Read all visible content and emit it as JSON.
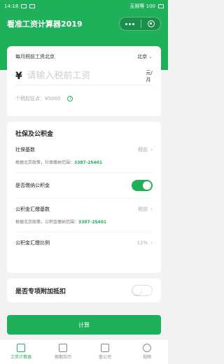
{
  "status_bar": {
    "time": "14:18",
    "right_text": "无限等 100"
  },
  "header": {
    "title": "看准工资计算器2019"
  },
  "salary": {
    "label": "每月税前工资北京",
    "city": "北京",
    "currency_symbol": "¥",
    "placeholder": "请输入税前工资",
    "unit": "元/月",
    "threshold_label": "个税起征点：¥5000"
  },
  "social": {
    "title": "社保及公积金",
    "base_label": "社保基数",
    "base_hint": "税前",
    "base_note_prefix": "根据北京政策，社保缴纳范围：",
    "base_range": "3387-25401",
    "fund_toggle_label": "是否缴纳公积金",
    "fund_base_label": "公积金汇缴基数",
    "fund_base_hint": "税前",
    "fund_note_prefix": "根据北京政策，公积金缴纳范围：",
    "fund_range": "3387-25401",
    "ratio_label": "公积金汇缴比例",
    "ratio_value": "12%",
    "fund_enabled": true
  },
  "special": {
    "label": "是否专项附加抵扣",
    "enabled": false
  },
  "calc_label": "计算",
  "tabs": [
    {
      "label": "工资计算器",
      "active": true
    },
    {
      "label": "假期日历",
      "active": false
    },
    {
      "label": "查公司",
      "active": false
    },
    {
      "label": "视频",
      "active": false
    }
  ],
  "colors": {
    "accent": "#1fb05a"
  }
}
